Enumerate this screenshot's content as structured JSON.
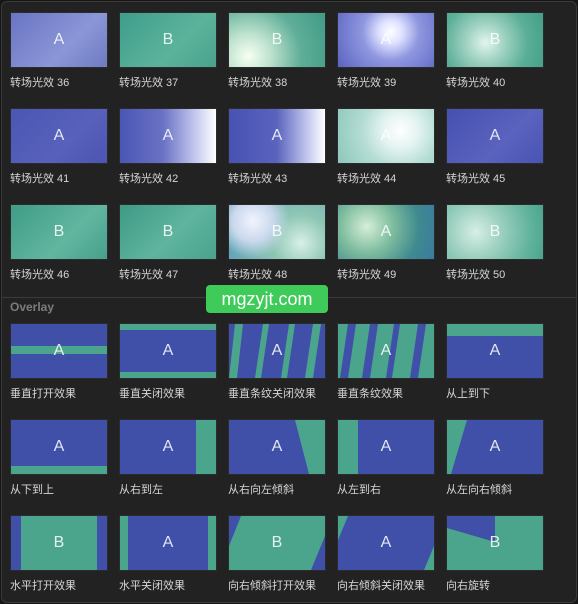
{
  "colors": {
    "overlay_blue": "#4050a8",
    "overlay_teal": "#4aa58c",
    "watermark_green": "#3fcb5a"
  },
  "transitions": [
    {
      "caption": "转场光效 36",
      "letter": "A"
    },
    {
      "caption": "转场光效 37",
      "letter": "B"
    },
    {
      "caption": "转场光效 38",
      "letter": "B"
    },
    {
      "caption": "转场光效 39",
      "letter": "A"
    },
    {
      "caption": "转场光效 40",
      "letter": "B"
    },
    {
      "caption": "转场光效 41",
      "letter": "A"
    },
    {
      "caption": "转场光效 42",
      "letter": "A"
    },
    {
      "caption": "转场光效 43",
      "letter": "A"
    },
    {
      "caption": "转场光效 44",
      "letter": "A"
    },
    {
      "caption": "转场光效 45",
      "letter": "A"
    },
    {
      "caption": "转场光效 46",
      "letter": "B"
    },
    {
      "caption": "转场光效 47",
      "letter": "B"
    },
    {
      "caption": "转场光效 48",
      "letter": "B"
    },
    {
      "caption": "转场光效 49",
      "letter": "A"
    },
    {
      "caption": "转场光效 50",
      "letter": "B"
    }
  ],
  "overlay_section": {
    "header": "Overlay",
    "items": [
      {
        "caption": "垂直打开效果",
        "letter": "A"
      },
      {
        "caption": "垂直关闭效果",
        "letter": "A"
      },
      {
        "caption": "垂直条纹关闭效果",
        "letter": "A"
      },
      {
        "caption": "垂直条纹效果",
        "letter": "A"
      },
      {
        "caption": "从上到下",
        "letter": "A"
      },
      {
        "caption": "从下到上",
        "letter": "A"
      },
      {
        "caption": "从右到左",
        "letter": "A"
      },
      {
        "caption": "从右向左倾斜",
        "letter": "A"
      },
      {
        "caption": "从左到右",
        "letter": "A"
      },
      {
        "caption": "从左向右倾斜",
        "letter": "A"
      },
      {
        "caption": "水平打开效果",
        "letter": "B"
      },
      {
        "caption": "水平关闭效果",
        "letter": "A"
      },
      {
        "caption": "向右倾斜打开效果",
        "letter": "B"
      },
      {
        "caption": "向右倾斜关闭效果",
        "letter": "A"
      },
      {
        "caption": "向右旋转",
        "letter": "B"
      }
    ]
  },
  "watermark": "mgzyjt.com"
}
